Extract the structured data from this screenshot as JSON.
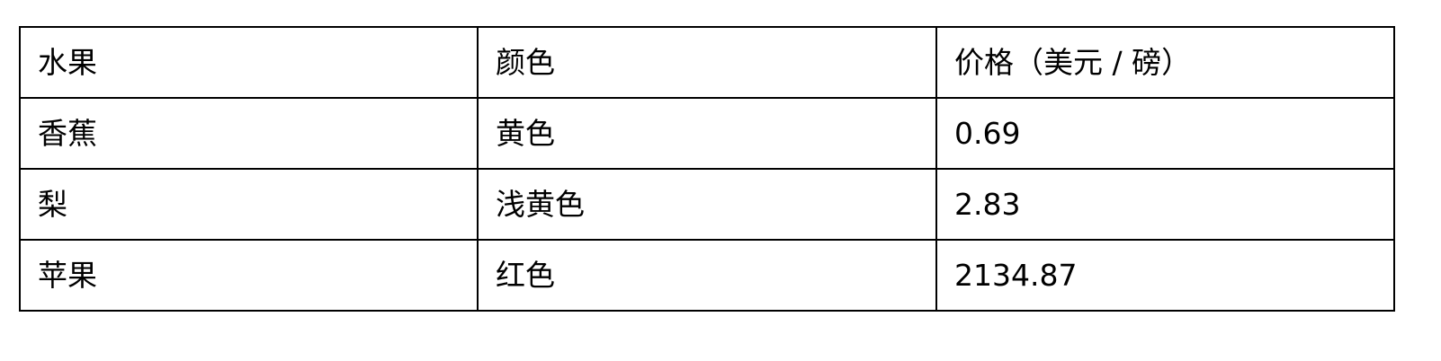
{
  "table": {
    "headers": [
      "水果",
      "颜色",
      "价格（美元 / 磅）"
    ],
    "rows": [
      [
        "香蕉",
        "黄色",
        "0.69"
      ],
      [
        "梨",
        "浅黄色",
        "2.83"
      ],
      [
        "苹果",
        "红色",
        "2134.87"
      ]
    ]
  },
  "colors": {
    "border": "#000000",
    "text": "#000000",
    "background": "#ffffff"
  }
}
